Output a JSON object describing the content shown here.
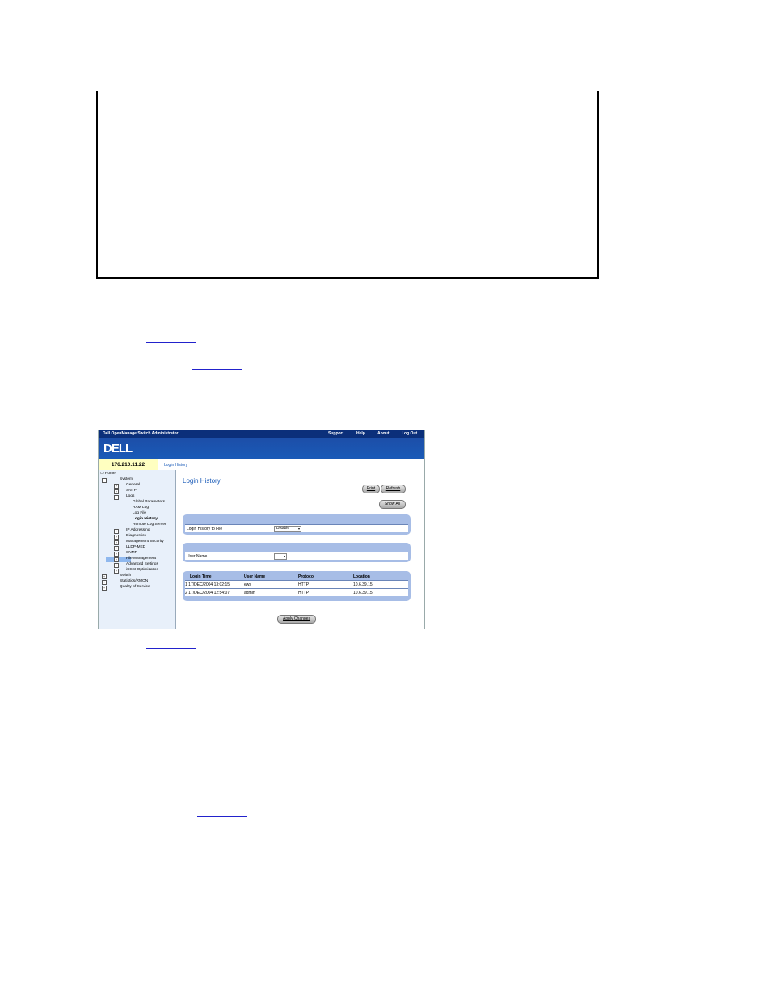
{
  "topbar": {
    "app_title": "Dell OpenManage Switch Administrator",
    "links": [
      "Support",
      "Help",
      "About",
      "Log Out"
    ]
  },
  "brand": {
    "logo": "DELL"
  },
  "device_ip": "176.210.11.22",
  "breadcrumb": "Login History",
  "tree": [
    "Home",
    "System",
    "General",
    "SNTP",
    "Logs",
    "Global Parameters",
    "RAM Log",
    "Log File",
    "Login History",
    "Remote Log Server",
    "IP Addressing",
    "Diagnostics",
    "Management Security",
    "LLDP-MED",
    "SNMP",
    "File Management",
    "Advanced Settings",
    "iSCSI Optimization",
    "Switch",
    "Statistics/RMON",
    "Quality of Service"
  ],
  "page": {
    "title": "Login History",
    "print_label": "Print",
    "refresh_label": "Refresh",
    "show_all_label": "Show All",
    "file_label": "Login History to File",
    "file_value": "Disable",
    "user_label": "User Name",
    "user_value": "",
    "apply_label": "Apply Changes"
  },
  "table": {
    "headers": [
      "Login Time",
      "User Name",
      "Protocol",
      "Location"
    ],
    "rows": [
      [
        "1 17/DEC/2004 13:02:15",
        "ews",
        "HTTP",
        "10.6.39.15"
      ],
      [
        "2 17/DEC/2004 12:54:07",
        "admin",
        "HTTP",
        "10.6.39.15"
      ]
    ]
  }
}
